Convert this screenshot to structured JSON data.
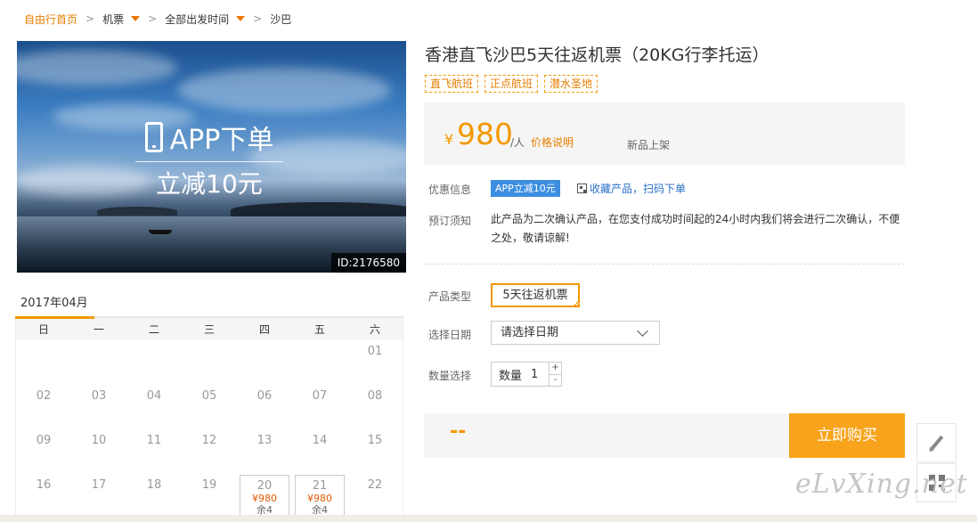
{
  "breadcrumb": {
    "home": "自由行首页",
    "category": "机票",
    "departure": "全部出发时间",
    "destination": "沙巴",
    "separator": ">"
  },
  "hero": {
    "app_text": "APP下单",
    "save_text": "立减10元",
    "product_id": "ID:2176580"
  },
  "calendar": {
    "month": "2017年04月",
    "weekdays": [
      "日",
      "一",
      "二",
      "三",
      "四",
      "五",
      "六"
    ],
    "cells": [
      {
        "day": ""
      },
      {
        "day": ""
      },
      {
        "day": ""
      },
      {
        "day": ""
      },
      {
        "day": ""
      },
      {
        "day": ""
      },
      {
        "day": "01"
      },
      {
        "day": "02"
      },
      {
        "day": "03"
      },
      {
        "day": "04"
      },
      {
        "day": "05"
      },
      {
        "day": "06"
      },
      {
        "day": "07"
      },
      {
        "day": "08"
      },
      {
        "day": "09"
      },
      {
        "day": "10"
      },
      {
        "day": "11"
      },
      {
        "day": "12"
      },
      {
        "day": "13"
      },
      {
        "day": "14"
      },
      {
        "day": "15"
      },
      {
        "day": "16"
      },
      {
        "day": "17"
      },
      {
        "day": "18"
      },
      {
        "day": "19"
      },
      {
        "day": "20",
        "price": "¥980",
        "left": "余4"
      },
      {
        "day": "21",
        "price": "¥980",
        "left": "余4"
      },
      {
        "day": "22"
      }
    ]
  },
  "product": {
    "title": "香港直飞沙巴5天往返机票（20KG行李托运）",
    "tags": [
      "直飞航班",
      "正点航班",
      "潜水圣地"
    ]
  },
  "price": {
    "currency": "¥",
    "amount": "980",
    "unit": "/人",
    "explain_link": "价格说明",
    "new_label": "新品上架"
  },
  "offers": {
    "label": "优惠信息",
    "badge": "APP立减10元",
    "links": "收藏产品，扫码下单"
  },
  "notice": {
    "label": "预订须知",
    "text": "此产品为二次确认产品，在您支付成功时间起的24小时内我们将会进行二次确认，不便之处，敬请谅解!"
  },
  "options": {
    "type_label": "产品类型",
    "type_value": "5天往返机票",
    "date_label": "选择日期",
    "date_value": "请选择日期",
    "qty_label": "数量选择",
    "qty_inner_label": "数量",
    "qty_value": "1",
    "qty_plus": "+",
    "qty_minus": "-"
  },
  "purchase": {
    "total": "--",
    "buy_label": "立即购买"
  },
  "watermark": "eLvXing.net",
  "colors": {
    "accent": "#f39800",
    "button": "#f8a31b",
    "link": "#2a70c8",
    "badge": "#3d8ee0"
  }
}
